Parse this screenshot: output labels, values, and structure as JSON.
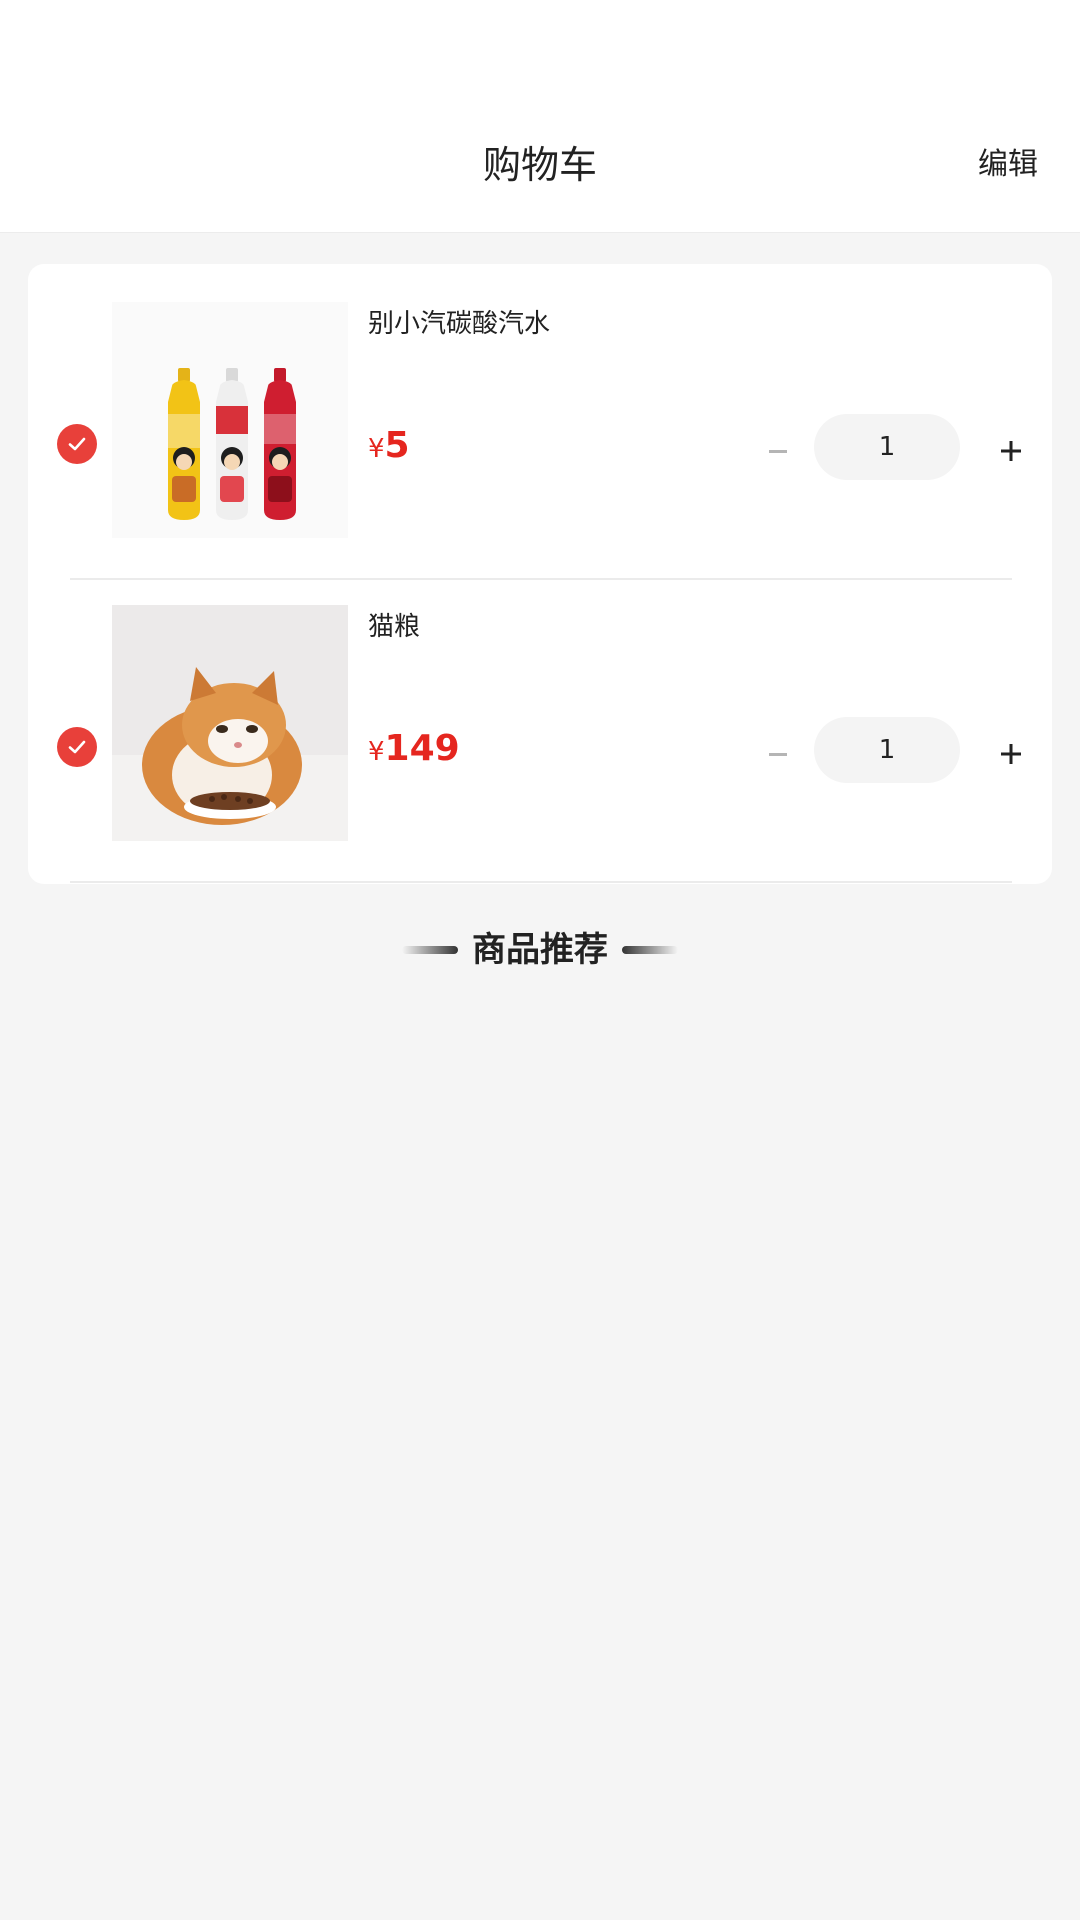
{
  "header": {
    "title": "购物车",
    "edit_label": "编辑"
  },
  "cart": {
    "items": [
      {
        "name": "别小汽碳酸汽水",
        "currency": "¥",
        "price": "5",
        "quantity": "1",
        "checked": true,
        "image": "three-soda-bottles-image"
      },
      {
        "name": "猫粮",
        "currency": "¥",
        "price": "149",
        "quantity": "1",
        "checked": true,
        "image": "kitten-eating-food-image"
      }
    ]
  },
  "recommendations": {
    "heading": "商品推荐"
  },
  "colors": {
    "accent": "#e8403a",
    "price": "#e5261f",
    "background": "#f5f5f5"
  }
}
